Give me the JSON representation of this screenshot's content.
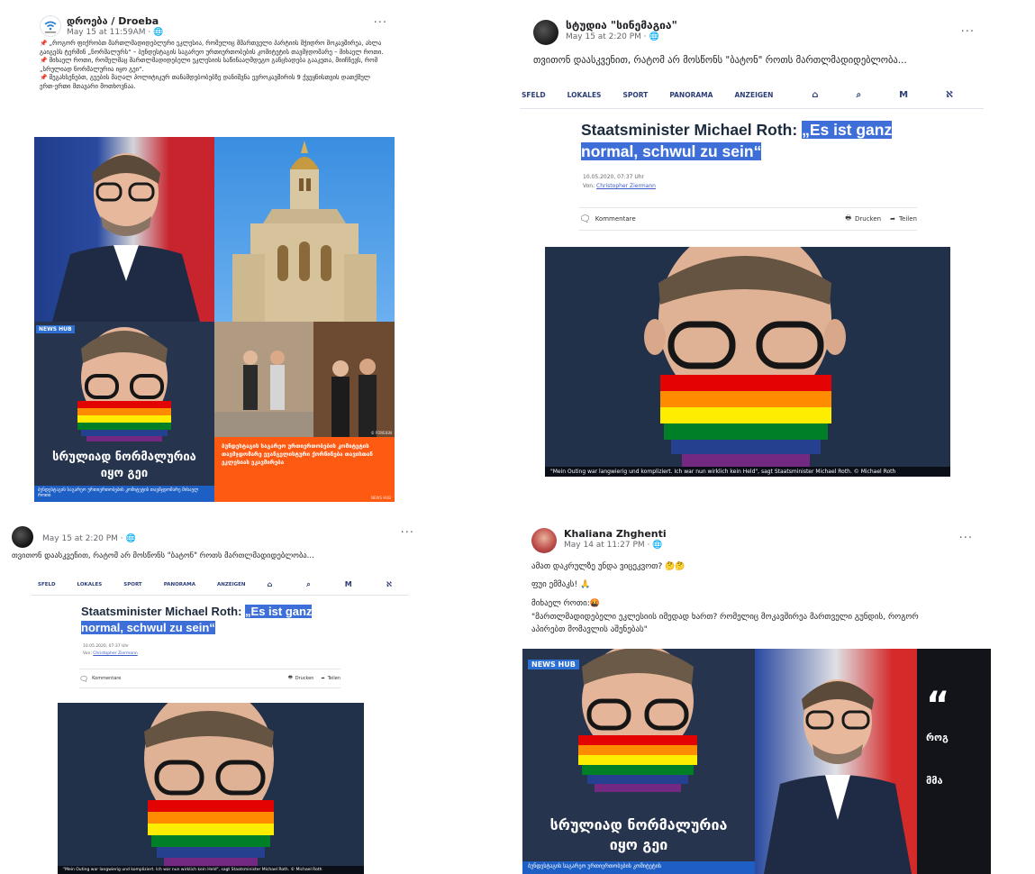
{
  "post1": {
    "author": "დროება / Droeba",
    "time": "May 15 at 11:59AM · ",
    "text": "📌 „როგორ ფიქრობთ მართლმადიდებლური ეკლესია, რომელიც მმართველი პარტიის მჭიდრო მოკავშირეა, ახლა გაიგებს ტერმინ „ნორმალურს“ – ბუნდესტაგის საგარეო ურთიერთობების კომიტეტის თავმჯდომარე – მიხაელ როთი.\n📌 მიხაელ როთი, რომელმაც მართლმადიდებელი ეკლესიის საწინააღმდეგო განცხადება გააკეთა, მიიჩნევს, რომ „სრულიად ნორმალურია იყო გეი“.\n📌 შეგახსენებთ, გეების მაღალ პოლიტიკურ თანამდებობებზე დანიშვნა ევროკავშირის 9 ქვეყნისთვის დათქმულ ერთ-ერთი მთავარი მოთხოვნაა.",
    "dots": "···",
    "newshub": "NEWS HUB",
    "banner": "სრულიად ნორმალურია იყო გეი",
    "banner_sub": "ბუნდესტაგის საგარეო ურთიერთობების კომიტეტის თავმჯდომარე მიხაელ როთი",
    "orange_text": "ბუნდესტაგის საგარეო ურთიერთობების კომიტეტის თავმჯდომარე ევანგელისტური ქორწინება თავისთან ეკლესიას ეკავშირება",
    "photo_tag": "© FOREIGN",
    "photo_tag2": "NEWS HUB"
  },
  "post2": {
    "author": "სტუდია \"სინემაგია\"",
    "time": "May 15 at 2:20 PM · ",
    "text": "თვითონ დაასკვენით, რატომ არ მოსწონს \"ბატონ\" როთს მართლმადიდებლობა...",
    "dots": "···"
  },
  "post3": {
    "time": "May 15 at 2:20 PM · ",
    "text": "თვითონ დაასკვენით, რატომ არ მოსწონს \"ბატონ\" როთს მართლმადიდებლობა...",
    "dots": "···"
  },
  "post4": {
    "author": "Khaliana Zhghenti",
    "time": "May 14 at 11:27 PM · ",
    "line1": "ამათ დაკრულზე უნდა ვიცეკვოთ? 🤔🤔",
    "line2": "ფუი ემმაკს! 🙏",
    "line3": "მიხაელ როთი:🤬",
    "line4": "\"მართლმადიდებელი ეკლესიის იმედად ხართ? რომელიც მოკავშირეა მართველი გუნდის, როგორ აპირებთ მომავლის აშენებას\"",
    "dots": "···",
    "newshub": "NEWS HUB",
    "banner": "სრულიად ნორმალურია იყო გეი",
    "banner_sub": "ბუნდესტაგის საგარეო ურთიერთობების კომიტეტის",
    "quote_mark": "“",
    "quote_1": "როგ",
    "quote_2": "მმა"
  },
  "article": {
    "nav": [
      "SFELD",
      "LOKALES",
      "SPORT",
      "PANORAMA",
      "ANZEIGEN"
    ],
    "nav_full": [
      "SFELD",
      "LOKALES",
      "SPORT",
      "PANORAMA",
      "ANZEIGEN"
    ],
    "headline_plain": "Staatsminister Michael Roth: ",
    "headline_hl1": "„Es ist ganz",
    "headline_hl2": "normal, schwul zu sein“",
    "date": "10.05.2020, 07:37 Uhr",
    "by_label": "Von: ",
    "author": "Christopher Ziermann",
    "comments": "Kommentare",
    "print": "Drucken",
    "share": "Teilen",
    "caption": "\"Mein Outing war langwierig und kompliziert. Ich war nun wirklich kein Held\", sagt Staatsminister Michael Roth. © Michael Roth"
  }
}
